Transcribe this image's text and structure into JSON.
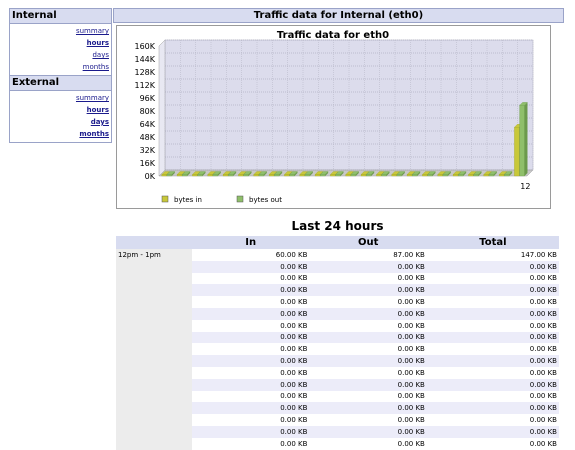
{
  "nav": {
    "internal": {
      "heading": "Internal",
      "links": [
        "summary",
        "hours",
        "days",
        "months"
      ]
    },
    "external": {
      "heading": "External",
      "links": [
        "summary",
        "hours",
        "days",
        "months"
      ]
    }
  },
  "header": {
    "title": "Traffic data for Internal (eth0)"
  },
  "chart_data": {
    "type": "bar",
    "title": "Traffic data for eth0",
    "y_ticks": [
      "0K",
      "16K",
      "32K",
      "48K",
      "64K",
      "80K",
      "96K",
      "112K",
      "128K",
      "144K",
      "160K"
    ],
    "ylim": [
      0,
      160
    ],
    "unit": "K",
    "x_label": "12",
    "series": [
      {
        "name": "bytes in",
        "color": "#c8c83a",
        "values": [
          0,
          0,
          0,
          0,
          0,
          0,
          0,
          0,
          0,
          0,
          0,
          0,
          0,
          0,
          0,
          0,
          0,
          0,
          0,
          0,
          0,
          0,
          0,
          60
        ]
      },
      {
        "name": "bytes out",
        "color": "#8fbf6a",
        "values": [
          0,
          0,
          0,
          0,
          0,
          0,
          0,
          0,
          0,
          0,
          0,
          0,
          0,
          0,
          0,
          0,
          0,
          0,
          0,
          0,
          0,
          0,
          0,
          87
        ]
      }
    ],
    "grid": true,
    "legend": "bottom-left"
  },
  "table": {
    "title": "Last 24 hours",
    "headers": [
      "",
      "In",
      "Out",
      "Total"
    ],
    "rows": [
      [
        "12pm - 1pm",
        "60.00 KB",
        "87.00 KB",
        "147.00 KB"
      ],
      [
        "",
        "0.00 KB",
        "0.00 KB",
        "0.00 KB"
      ],
      [
        "",
        "0.00 KB",
        "0.00 KB",
        "0.00 KB"
      ],
      [
        "",
        "0.00 KB",
        "0.00 KB",
        "0.00 KB"
      ],
      [
        "",
        "0.00 KB",
        "0.00 KB",
        "0.00 KB"
      ],
      [
        "",
        "0.00 KB",
        "0.00 KB",
        "0.00 KB"
      ],
      [
        "",
        "0.00 KB",
        "0.00 KB",
        "0.00 KB"
      ],
      [
        "",
        "0.00 KB",
        "0.00 KB",
        "0.00 KB"
      ],
      [
        "",
        "0.00 KB",
        "0.00 KB",
        "0.00 KB"
      ],
      [
        "",
        "0.00 KB",
        "0.00 KB",
        "0.00 KB"
      ],
      [
        "",
        "0.00 KB",
        "0.00 KB",
        "0.00 KB"
      ],
      [
        "",
        "0.00 KB",
        "0.00 KB",
        "0.00 KB"
      ],
      [
        "",
        "0.00 KB",
        "0.00 KB",
        "0.00 KB"
      ],
      [
        "",
        "0.00 KB",
        "0.00 KB",
        "0.00 KB"
      ],
      [
        "",
        "0.00 KB",
        "0.00 KB",
        "0.00 KB"
      ],
      [
        "",
        "0.00 KB",
        "0.00 KB",
        "0.00 KB"
      ],
      [
        "",
        "0.00 KB",
        "0.00 KB",
        "0.00 KB"
      ]
    ]
  }
}
